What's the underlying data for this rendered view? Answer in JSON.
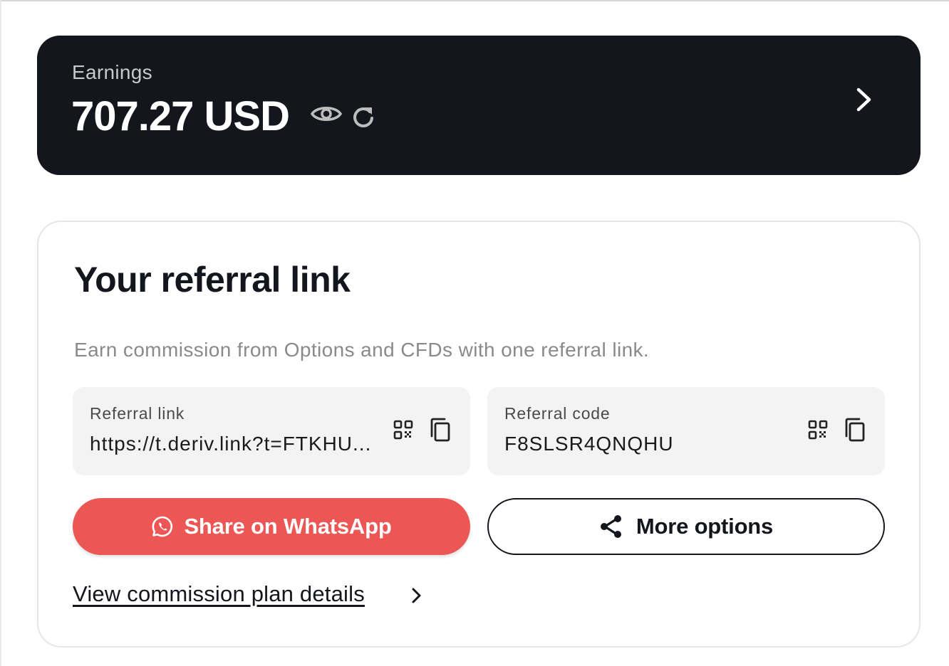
{
  "earnings": {
    "label": "Earnings",
    "value": "707.27 USD",
    "icons": [
      "eye-icon",
      "refresh-icon",
      "chevron-right-icon"
    ]
  },
  "referral": {
    "title": "Your referral link",
    "description": "Earn commission from Options and CFDs with one referral link.",
    "link_field": {
      "label": "Referral link",
      "value": "https://t.deriv.link?t=FTKHU..."
    },
    "code_field": {
      "label": "Referral code",
      "value": "F8SLSR4QNQHU"
    },
    "whatsapp_button": "Share on WhatsApp",
    "more_options_button": "More options",
    "commission_link": "View commission plan details"
  },
  "colors": {
    "earnings_card_bg": "#13161c",
    "whatsapp_button_bg": "#ec5755",
    "field_bg": "#f3f3f3"
  }
}
